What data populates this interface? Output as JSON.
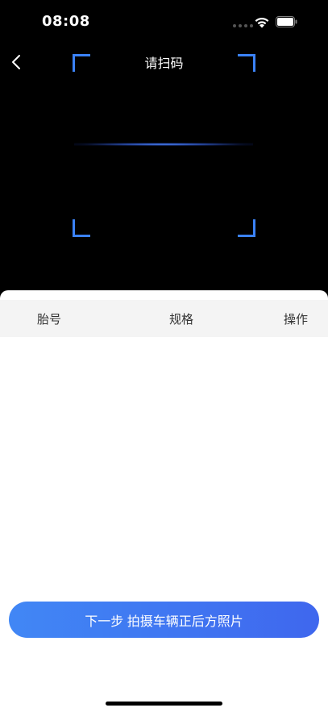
{
  "status_bar": {
    "time": "08:08",
    "wifi_icon": "wifi-icon",
    "battery_icon": "battery-icon"
  },
  "header": {
    "back_icon": "chevron-left-icon",
    "title": "请扫码"
  },
  "scanner": {
    "accent_color": "#3b82f6"
  },
  "table": {
    "columns": [
      "胎号",
      "规格",
      "操作"
    ],
    "rows": []
  },
  "footer": {
    "next_button_label": "下一步 拍摄车辆正后方照片",
    "button_gradient": [
      "#4187f5",
      "#3f67ee"
    ]
  }
}
